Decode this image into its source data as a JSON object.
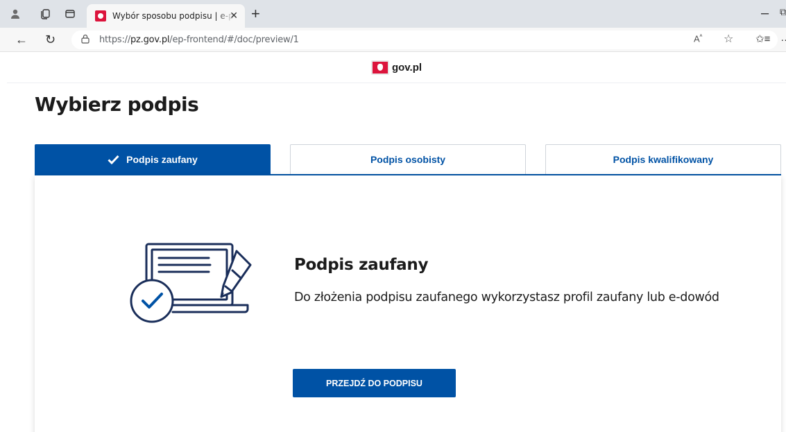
{
  "browser": {
    "tab_title": "Wybór sposobu podpisu | e-podpis",
    "url_prefix": "https://",
    "url_host": "pz.gov.pl",
    "url_path": "/ep-frontend/#/doc/preview/1"
  },
  "header": {
    "logo_text": "gov.pl"
  },
  "page": {
    "title": "Wybierz podpis"
  },
  "signature_tabs": [
    {
      "label": "Podpis zaufany",
      "active": true
    },
    {
      "label": "Podpis osobisty",
      "active": false
    },
    {
      "label": "Podpis kwalifikowany",
      "active": false
    }
  ],
  "content": {
    "title": "Podpis zaufany",
    "description": "Do złożenia podpisu zaufanego wykorzystasz profil zaufany lub e-dowód",
    "button_label": "PRZEJDŹ DO PODPISU"
  },
  "colors": {
    "primary": "#0052a5",
    "navy": "#1a2e5a",
    "emblem_red": "#dc143c"
  }
}
